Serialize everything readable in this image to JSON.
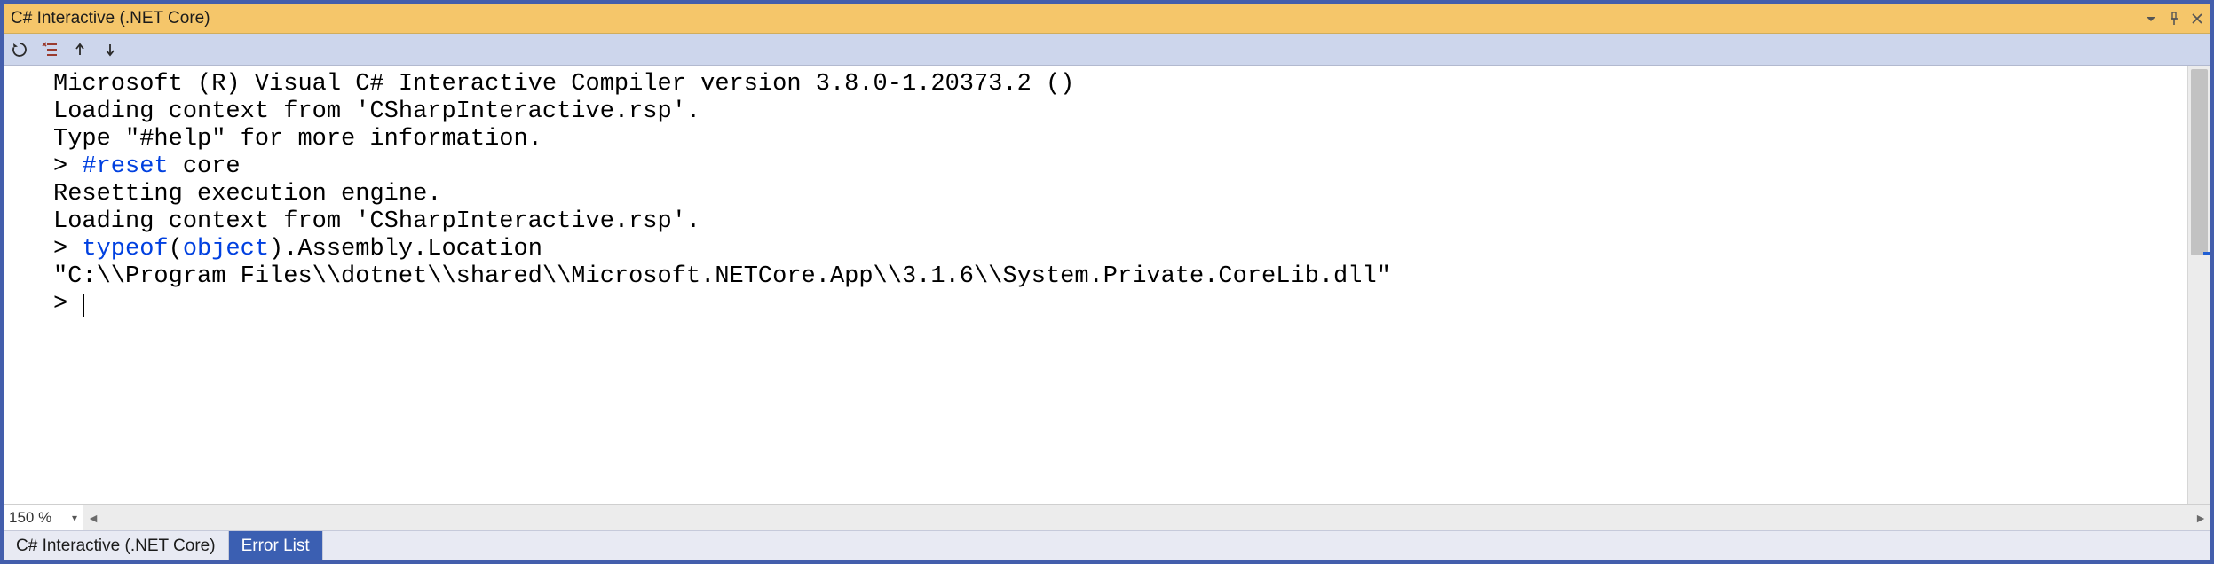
{
  "window": {
    "title": "C# Interactive (.NET Core)"
  },
  "toolbar": {
    "reset_tooltip": "Reset",
    "clear_tooltip": "Clear",
    "history_prev_tooltip": "History Previous",
    "history_next_tooltip": "History Next"
  },
  "zoom": {
    "level": "150 %"
  },
  "tabs": [
    {
      "label": "C# Interactive (.NET Core)",
      "active": true
    },
    {
      "label": "Error List",
      "active": false
    }
  ],
  "console": {
    "lines": [
      {
        "type": "text",
        "text": "Microsoft (R) Visual C# Interactive Compiler version 3.8.0-1.20373.2 ()"
      },
      {
        "type": "text",
        "text": "Loading context from 'CSharpInteractive.rsp'."
      },
      {
        "type": "text",
        "text": "Type \"#help\" for more information."
      },
      {
        "type": "input",
        "prompt": "> ",
        "segments": [
          {
            "t": "#reset",
            "c": "kw-blue"
          },
          {
            "t": " core",
            "c": ""
          }
        ]
      },
      {
        "type": "text",
        "text": "Resetting execution engine."
      },
      {
        "type": "text",
        "text": "Loading context from 'CSharpInteractive.rsp'."
      },
      {
        "type": "input",
        "prompt": "> ",
        "segments": [
          {
            "t": "typeof",
            "c": "kw-blue"
          },
          {
            "t": "(",
            "c": ""
          },
          {
            "t": "object",
            "c": "kw-blue"
          },
          {
            "t": ").Assembly.Location",
            "c": ""
          }
        ]
      },
      {
        "type": "text",
        "text": "\"C:\\\\Program Files\\\\dotnet\\\\shared\\\\Microsoft.NETCore.App\\\\3.1.6\\\\System.Private.CoreLib.dll\""
      },
      {
        "type": "prompt",
        "prompt": "> "
      }
    ]
  }
}
